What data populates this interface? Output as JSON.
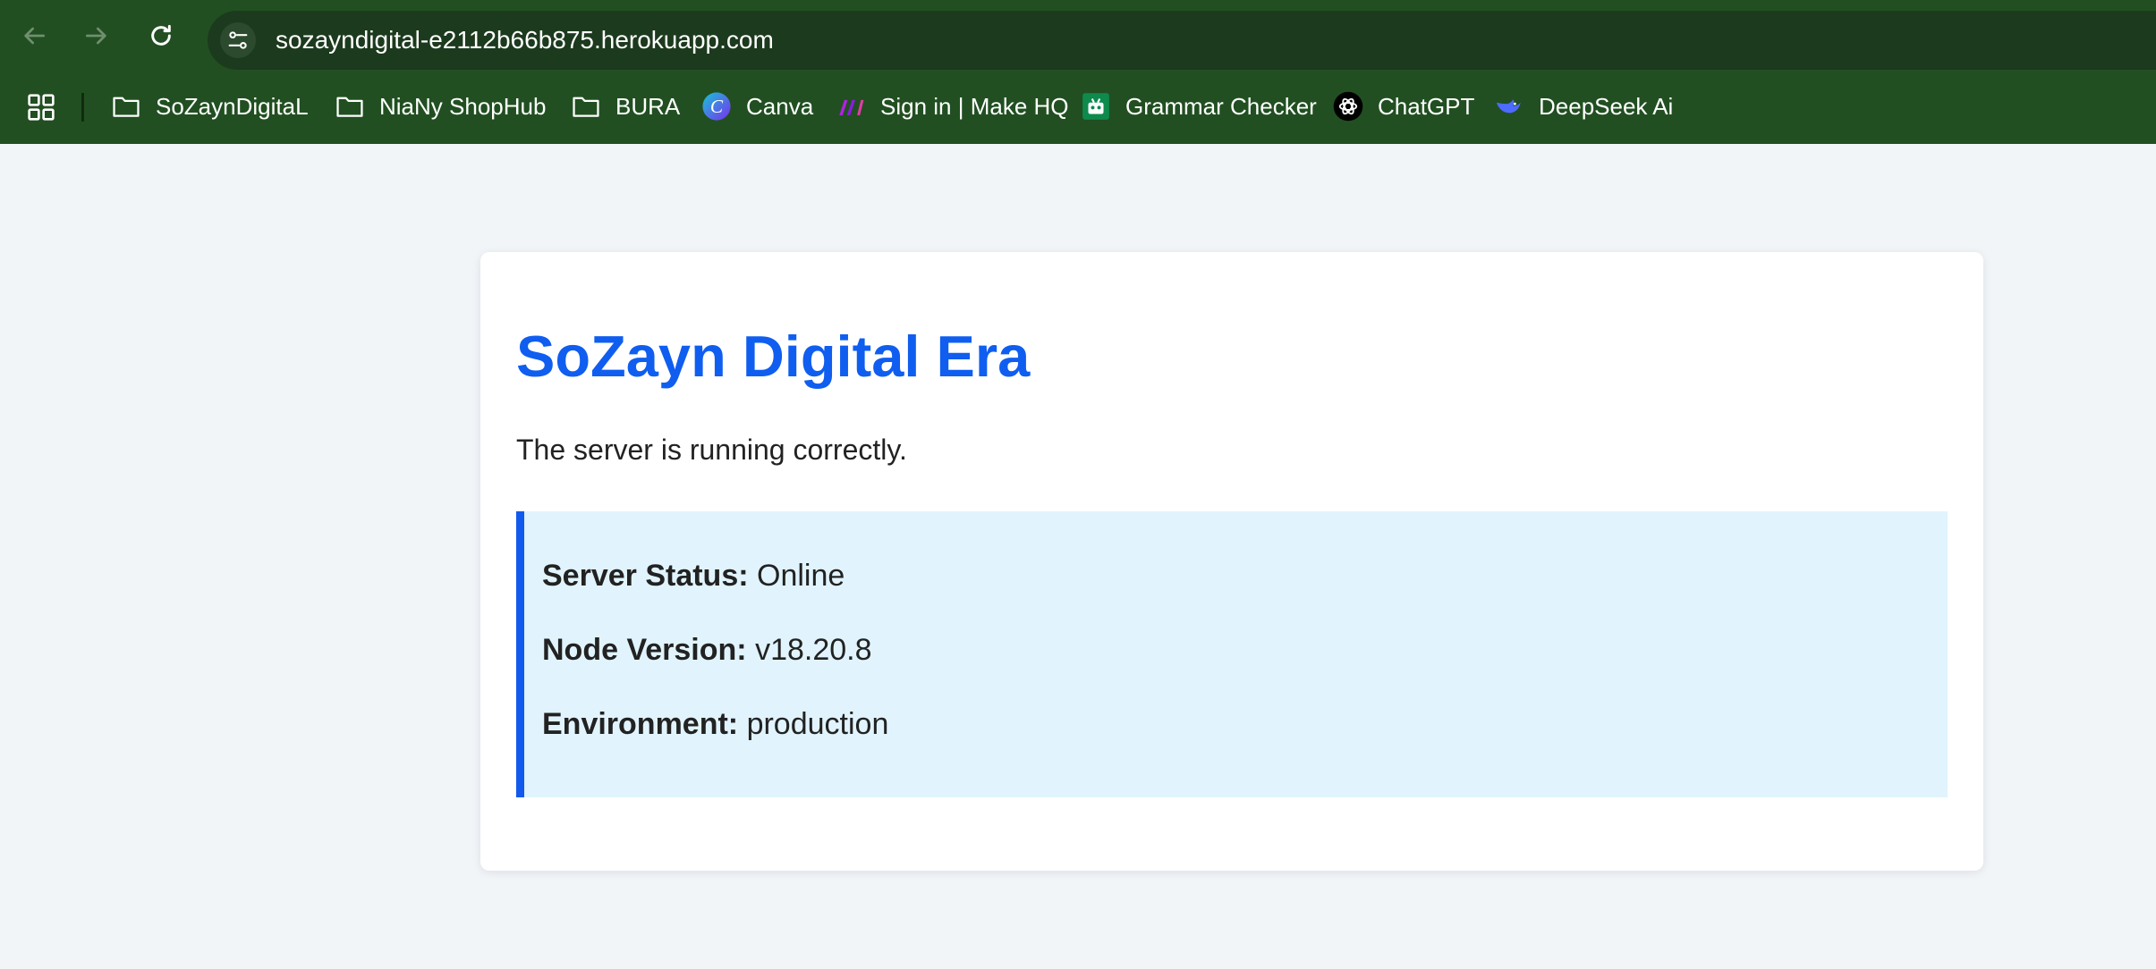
{
  "browser": {
    "url": "sozayndigital-e2112b66b875.herokuapp.com",
    "bookmarks": [
      {
        "label": "SoZaynDigitaL",
        "icon": "folder-icon"
      },
      {
        "label": "NiaNy ShopHub",
        "icon": "folder-icon"
      },
      {
        "label": "BURA",
        "icon": "folder-icon"
      },
      {
        "label": "Canva",
        "icon": "canva-icon"
      },
      {
        "label": "Sign in | Make HQ",
        "icon": "make-icon"
      },
      {
        "label": "Grammar Checker",
        "icon": "grammar-checker-icon"
      },
      {
        "label": "ChatGPT",
        "icon": "chatgpt-icon"
      },
      {
        "label": "DeepSeek Ai",
        "icon": "deepseek-icon"
      }
    ]
  },
  "page": {
    "title": "SoZayn Digital Era",
    "message": "The server is running correctly.",
    "status": {
      "server_status_label": "Server Status:",
      "server_status_value": "Online",
      "node_version_label": "Node Version:",
      "node_version_value": "v18.20.8",
      "environment_label": "Environment:",
      "environment_value": "production"
    }
  },
  "colors": {
    "chrome": "#214f21",
    "title": "#0f5ef0",
    "accent_border": "#1259ee",
    "info_bg": "#e1f4fd"
  }
}
